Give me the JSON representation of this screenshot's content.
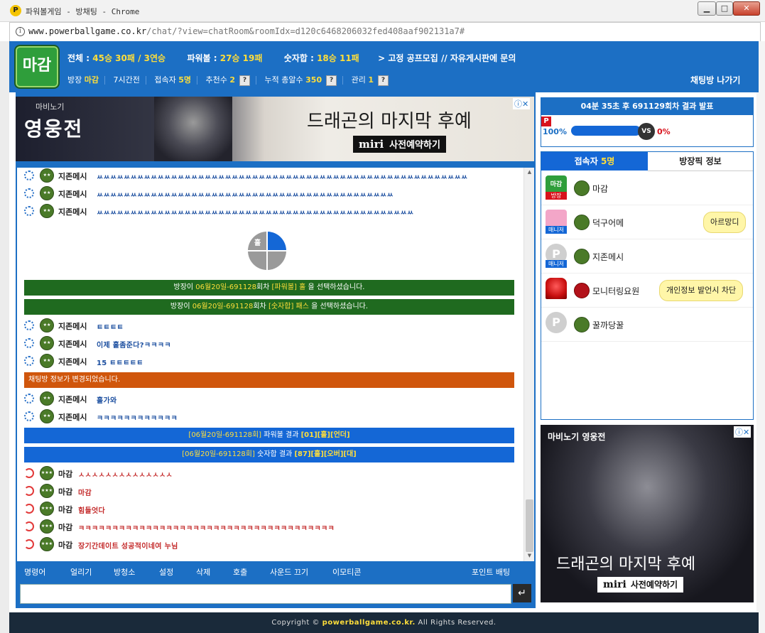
{
  "window": {
    "title": "파워볼게임 - 방채팅 - Chrome",
    "minimize_label": "▁",
    "maximize_label": "□",
    "close_label": "✕",
    "app_logo": "P"
  },
  "address": {
    "domain": "www.powerballgame.co.kr",
    "path": "/chat/?view=chatRoom&roomIdx=d120c6468206032fed408aaf902131a7#"
  },
  "header": {
    "logo_text": "마감",
    "stats": {
      "total_label": "전체 : ",
      "total_value": "45승 30패 / 3연승",
      "powerball_label": "파워볼 : ",
      "powerball_value": "27승 19패",
      "number_label": "숫자합 : ",
      "number_value": "18승 11패",
      "notice": "> 고정 공프모집 // 자유게시판에 문의"
    },
    "sub": {
      "owner_label": "방장",
      "owner_value": "마감",
      "time": "7시간전",
      "users_label": "접속자",
      "users_value": "5명",
      "recommend_label": "추천수",
      "recommend_value": "2",
      "cumulative_label": "누적 총알수",
      "cumulative_value": "350",
      "admin_label": "관리",
      "admin_value": "1",
      "help": "?"
    },
    "leave": "채팅방 나가기"
  },
  "top_ad": {
    "game_small": "마비노기",
    "game_title": "영웅전",
    "headline": "드래곤의 마지막 후예",
    "brand": "miri",
    "cta": "사전예약하기",
    "close": "ⓘ✕"
  },
  "chat": {
    "messages_top": [
      {
        "name": "지존메시",
        "text": "ㅆㅆㅆㅆㅆㅆㅆㅆㅆㅆㅆㅆㅆㅆㅆㅆㅆㅆㅆㅆㅆㅆㅆㅆㅆㅆㅆㅆㅆㅆㅆㅆㅆㅆㅆㅆㅆㅆㅆㅆㅆㅆㅆㅆㅆㅆㅆㅆㅆㅆㅆㅆㅆㅆㅆ"
      },
      {
        "name": "지존메시",
        "text": "ㅆㅆㅆㅆㅆㅆㅆㅆㅆㅆㅆㅆㅆㅆㅆㅆㅆㅆㅆㅆㅆㅆㅆㅆㅆㅆㅆㅆㅆㅆㅆㅆㅆㅆㅆㅆㅆㅆㅆㅆㅆㅆㅆㅆ"
      },
      {
        "name": "지존메시",
        "text": "ㅆㅆㅆㅆㅆㅆㅆㅆㅆㅆㅆㅆㅆㅆㅆㅆㅆㅆㅆㅆㅆㅆㅆㅆㅆㅆㅆㅆㅆㅆㅆㅆㅆㅆㅆㅆㅆㅆㅆㅆㅆㅆㅆㅆㅆㅆㅆ"
      }
    ],
    "pie_label": "홀",
    "sys1": {
      "pre": "방장이 ",
      "date": "06월20일-691128",
      "mid": "회차 ",
      "pick": "[파워볼] 홀",
      "post": " 을 선택하셨습니다."
    },
    "sys2": {
      "pre": "방장이 ",
      "date": "06월20일-691128",
      "mid": "회차 ",
      "pick": "[숫자합] 패스",
      "post": " 을 선택하셨습니다."
    },
    "messages_mid": [
      {
        "name": "지존메시",
        "text": "ㅌㅌㅌㅌ"
      },
      {
        "name": "지존메시",
        "text": "이제 홀좀준다?ㅋㅋㅋㅋ"
      },
      {
        "name": "지존메시",
        "text": "15 ㅌㅌㅌㅌㅌ"
      }
    ],
    "sys_changed": "채팅방 정보가 변경되었습니다.",
    "messages_mid2": [
      {
        "name": "지존메시",
        "text": "홀가와"
      },
      {
        "name": "지존메시",
        "text": "ㅋㅋㅋㅋㅋㅋㅋㅋㅋㅋㅋㅋ"
      }
    ],
    "result1": {
      "pre": "[06월20일-691128회]",
      "mid": " 파워볼 결과 ",
      "r": "[01][홀][언더]"
    },
    "result2": {
      "pre": "[06월20일-691128회]",
      "mid": " 숫자합 결과 ",
      "r": "[87][홀][오버][대]"
    },
    "messages_bottom": [
      {
        "name": "마감",
        "text": "ㅅㅅㅅㅅㅅㅅㅅㅅㅅㅅㅅㅅㅅㅅ"
      },
      {
        "name": "마감",
        "text": "마감"
      },
      {
        "name": "마감",
        "text": "힘들엇다"
      },
      {
        "name": "마감",
        "text": "ㅋㅋㅋㅋㅋㅋㅋㅋㅋㅋㅋㅋㅋㅋㅋㅋㅋㅋㅋㅋㅋㅋㅋㅋㅋㅋㅋㅋㅋㅋㅋㅋㅋㅋㅋㅋㅋㅋ"
      },
      {
        "name": "마감",
        "text": "장기간데이트 성공적이네여 누님"
      }
    ]
  },
  "toolbar": {
    "commands": "명령어",
    "freeze": "얼리기",
    "listen": "방청소",
    "settings": "설정",
    "delete": "삭제",
    "call": "호출",
    "sound_off": "사운드 끄기",
    "emoticon": "이모티콘",
    "point_bet": "포인트 배팅",
    "send": "↵"
  },
  "result_box": {
    "header": "04분 35초 후 691129회차 결과 발표",
    "p": "P",
    "left_pct": "100%",
    "vs": "VS",
    "right_pct": "0%"
  },
  "users_box": {
    "tab_users_label": "접속자 ",
    "tab_users_count": "5명",
    "tab_room": "방장픽 정보",
    "users": [
      {
        "name": "마감",
        "badge": "방장",
        "photo_text": "마감",
        "tip": ""
      },
      {
        "name": "덕구어메",
        "badge": "매니저",
        "photo_text": "",
        "tip": "아르망디"
      },
      {
        "name": "지존메시",
        "badge": "매니저",
        "photo_text": "P",
        "tip": ""
      },
      {
        "name": "모니터링요원",
        "badge": "",
        "photo_text": "",
        "tip": "개인정보 발언시 차단"
      },
      {
        "name": "꿀까당꿀",
        "badge": "",
        "photo_text": "P",
        "tip": ""
      }
    ]
  },
  "side_ad": {
    "game": "마비노기 영웅전",
    "headline": "드래곤의 마지막 후예",
    "brand": "miri",
    "cta": "사전예약하기",
    "close": "ⓘ✕"
  },
  "footer": {
    "pre": "Copyright © ",
    "domain": "powerballgame.co.kr.",
    "post": " All Rights Reserved."
  },
  "colors": {
    "brand_blue": "#1c6fc4",
    "result_blue": "#1467d6",
    "pick_green": "#1f6a1f",
    "notice_orange": "#d0560c",
    "highlight_yellow": "#ffde3a"
  }
}
